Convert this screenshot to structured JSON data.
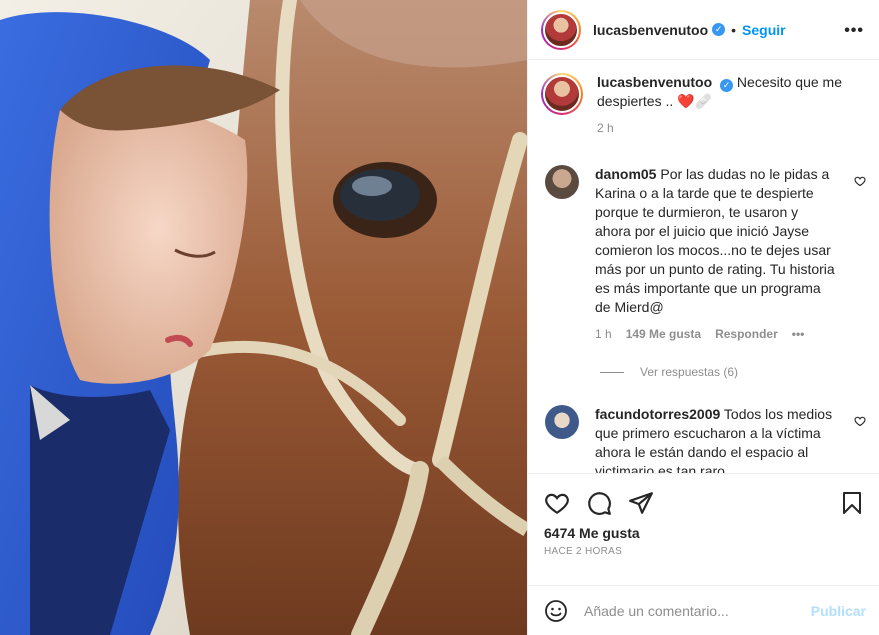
{
  "header": {
    "username": "lucasbenvenutoo",
    "separator": "•",
    "follow_label": "Seguir",
    "more_label": "•••"
  },
  "caption": {
    "username": "lucasbenvenutoo",
    "text": "Necesito que me despiertes .. ❤️🩹",
    "time": "2 h"
  },
  "comments": [
    {
      "username": "danom05",
      "text": "Por las dudas no le pidas a Karina o a la tarde que te despierte porque te durmieron, te usaron y ahora por el juicio que inició Jayse comieron los mocos...no te dejes usar más por un punto de rating. Tu historia es más importante que un programa de Mierd@",
      "time": "1 h",
      "likes": "149 Me gusta",
      "reply_label": "Responder",
      "more_label": "•••",
      "view_replies": "Ver respuestas (6)"
    },
    {
      "username": "facundotorres2009",
      "text": "Todos los medios que primero escucharon a la víctima ahora le están dando el espacio al victimario es tan raro"
    }
  ],
  "actions": {
    "icons": [
      "heart-icon",
      "comment-icon",
      "share-icon",
      "bookmark-icon"
    ],
    "likes": "6474 Me gusta",
    "time": "HACE 2 HORAS"
  },
  "add_comment": {
    "placeholder": "Añade un comentario...",
    "publish_label": "Publicar"
  },
  "colors": {
    "accent": "#0095f6",
    "publish_disabled": "#b2dffc",
    "verified": "#3897f0",
    "heart": "#e0245e"
  }
}
